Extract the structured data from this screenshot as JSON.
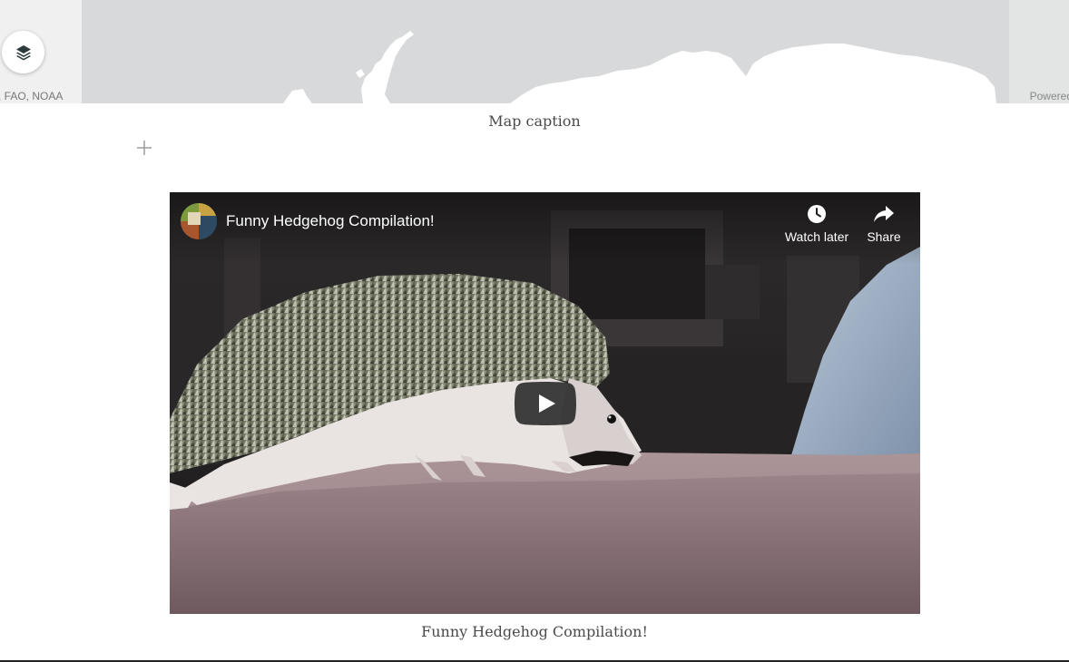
{
  "map": {
    "attribution_left": ", FAO, NOAA",
    "attribution_right": "Powered",
    "caption": "Map caption",
    "layers_icon": "layers-icon"
  },
  "editor": {
    "add_block_icon": "plus-icon"
  },
  "video": {
    "title": "Funny Hedgehog Compilation!",
    "watch_later_label": "Watch later",
    "share_label": "Share",
    "caption": "Funny Hedgehog Compilation!",
    "play_icon": "play-icon",
    "watch_later_icon": "clock-icon",
    "share_icon": "share-arrow-icon"
  },
  "colors": {
    "map_tiles": "#d7d9da",
    "map_land": "#ffffff",
    "caption_text": "#4a4a4a",
    "play_button": "#212121"
  }
}
